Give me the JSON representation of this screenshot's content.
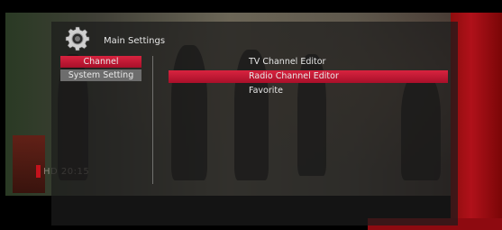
{
  "menu": {
    "title": "Main Settings",
    "categories": [
      {
        "label": "Channel",
        "selected": true
      },
      {
        "label": "System Setting",
        "selected": false
      }
    ],
    "options": [
      {
        "label": "TV Channel Editor",
        "selected": false
      },
      {
        "label": "Radio Channel Editor",
        "selected": true
      },
      {
        "label": "Favorite",
        "selected": false
      }
    ]
  },
  "background": {
    "channel_watermark": "HD 20:15"
  },
  "colors": {
    "highlight": "#c8173a",
    "inactive_item": "#6d6d6d",
    "overlay": "#1c1c1c"
  },
  "icons": {
    "header_icon": "gear-icon"
  }
}
